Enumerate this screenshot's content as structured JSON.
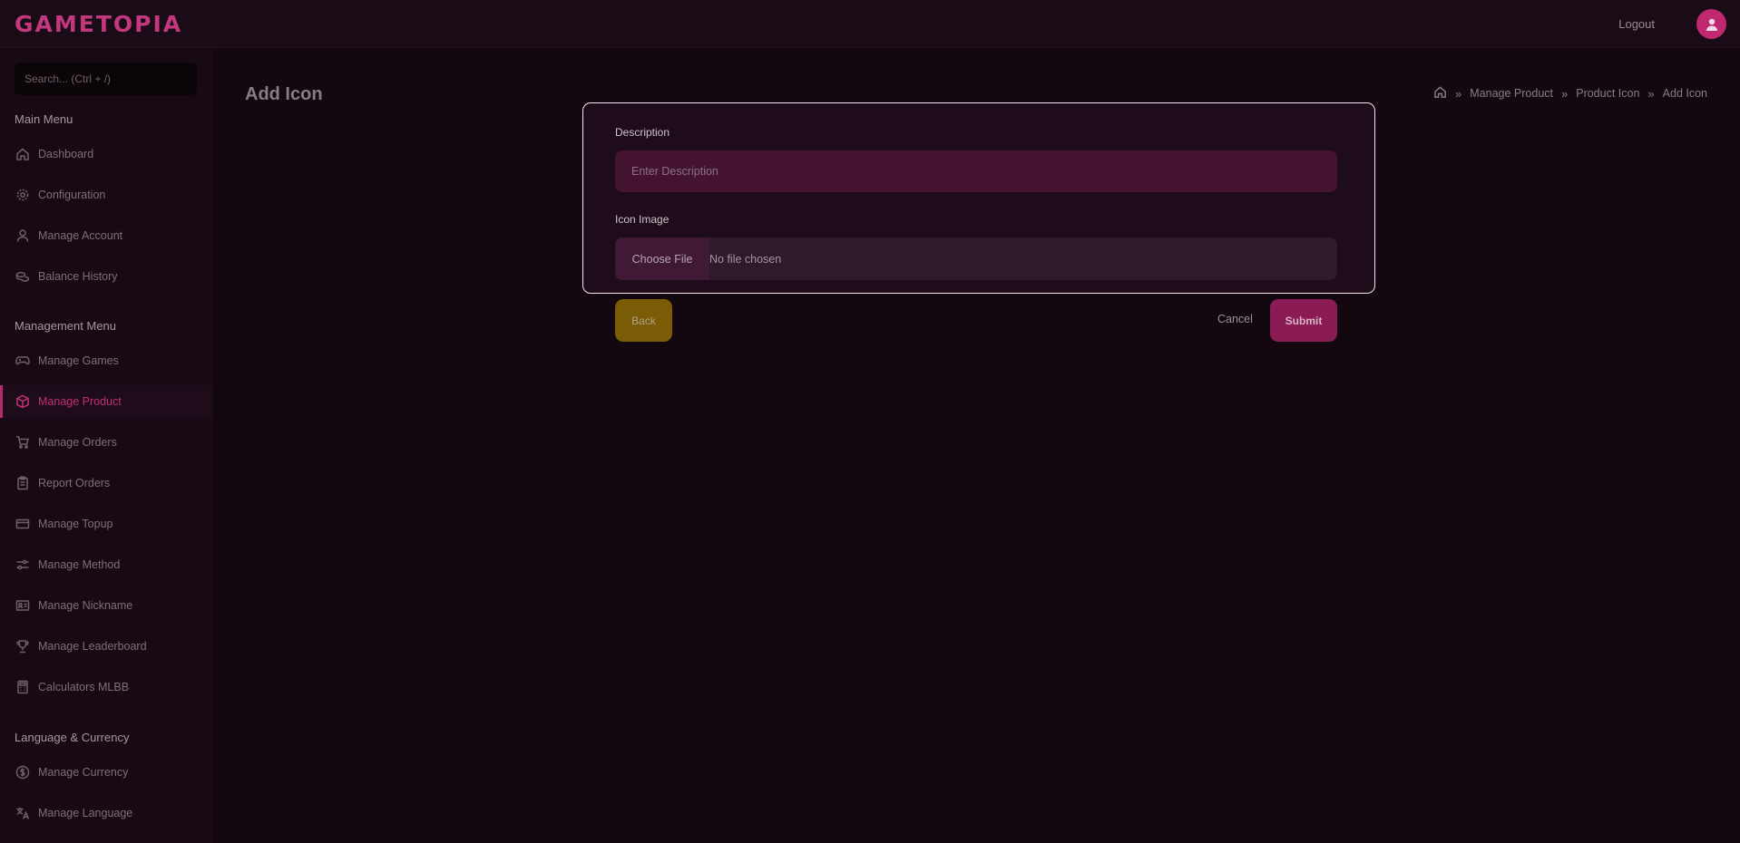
{
  "header": {
    "logo_text": "GAMETOPIA",
    "logout_label": "Logout",
    "avatar_icon": "user-icon"
  },
  "sidebar": {
    "search_placeholder": "Search... (Ctrl + /)",
    "sections": [
      {
        "title": "Main Menu",
        "items": [
          {
            "label": "Dashboard",
            "icon": "home-icon"
          },
          {
            "label": "Configuration",
            "icon": "gear-icon"
          },
          {
            "label": "Manage Account",
            "icon": "user-icon"
          },
          {
            "label": "Balance History",
            "icon": "coins-icon"
          }
        ]
      },
      {
        "title": "Management Menu",
        "items": [
          {
            "label": "Manage Games",
            "icon": "gamepad-icon"
          },
          {
            "label": "Manage Product",
            "icon": "box-icon",
            "active": true
          },
          {
            "label": "Manage Orders",
            "icon": "cart-icon"
          },
          {
            "label": "Report Orders",
            "icon": "clipboard-icon"
          },
          {
            "label": "Manage Topup",
            "icon": "card-icon"
          },
          {
            "label": "Manage Method",
            "icon": "sliders-icon"
          },
          {
            "label": "Manage Nickname",
            "icon": "id-card-icon"
          },
          {
            "label": "Manage Leaderboard",
            "icon": "trophy-icon"
          },
          {
            "label": "Calculators MLBB",
            "icon": "calculator-icon"
          }
        ]
      },
      {
        "title": "Language & Currency",
        "items": [
          {
            "label": "Manage Currency",
            "icon": "dollar-circle-icon"
          },
          {
            "label": "Manage Language",
            "icon": "translate-icon"
          }
        ]
      }
    ]
  },
  "main": {
    "page_title": "Add Icon",
    "breadcrumb": [
      "Manage Product",
      "Product Icon",
      "Add Icon"
    ],
    "form": {
      "description_label": "Description",
      "description_placeholder": "Enter Description",
      "description_value": "",
      "icon_image_label": "Icon Image",
      "file_button_label": "Choose File",
      "file_status": "No file chosen"
    },
    "actions": {
      "back_label": "Back",
      "cancel_label": "Cancel",
      "submit_label": "Submit"
    }
  },
  "colors": {
    "accent": "#c0286f",
    "back_button": "#7a5c07",
    "background": "#13080f"
  }
}
